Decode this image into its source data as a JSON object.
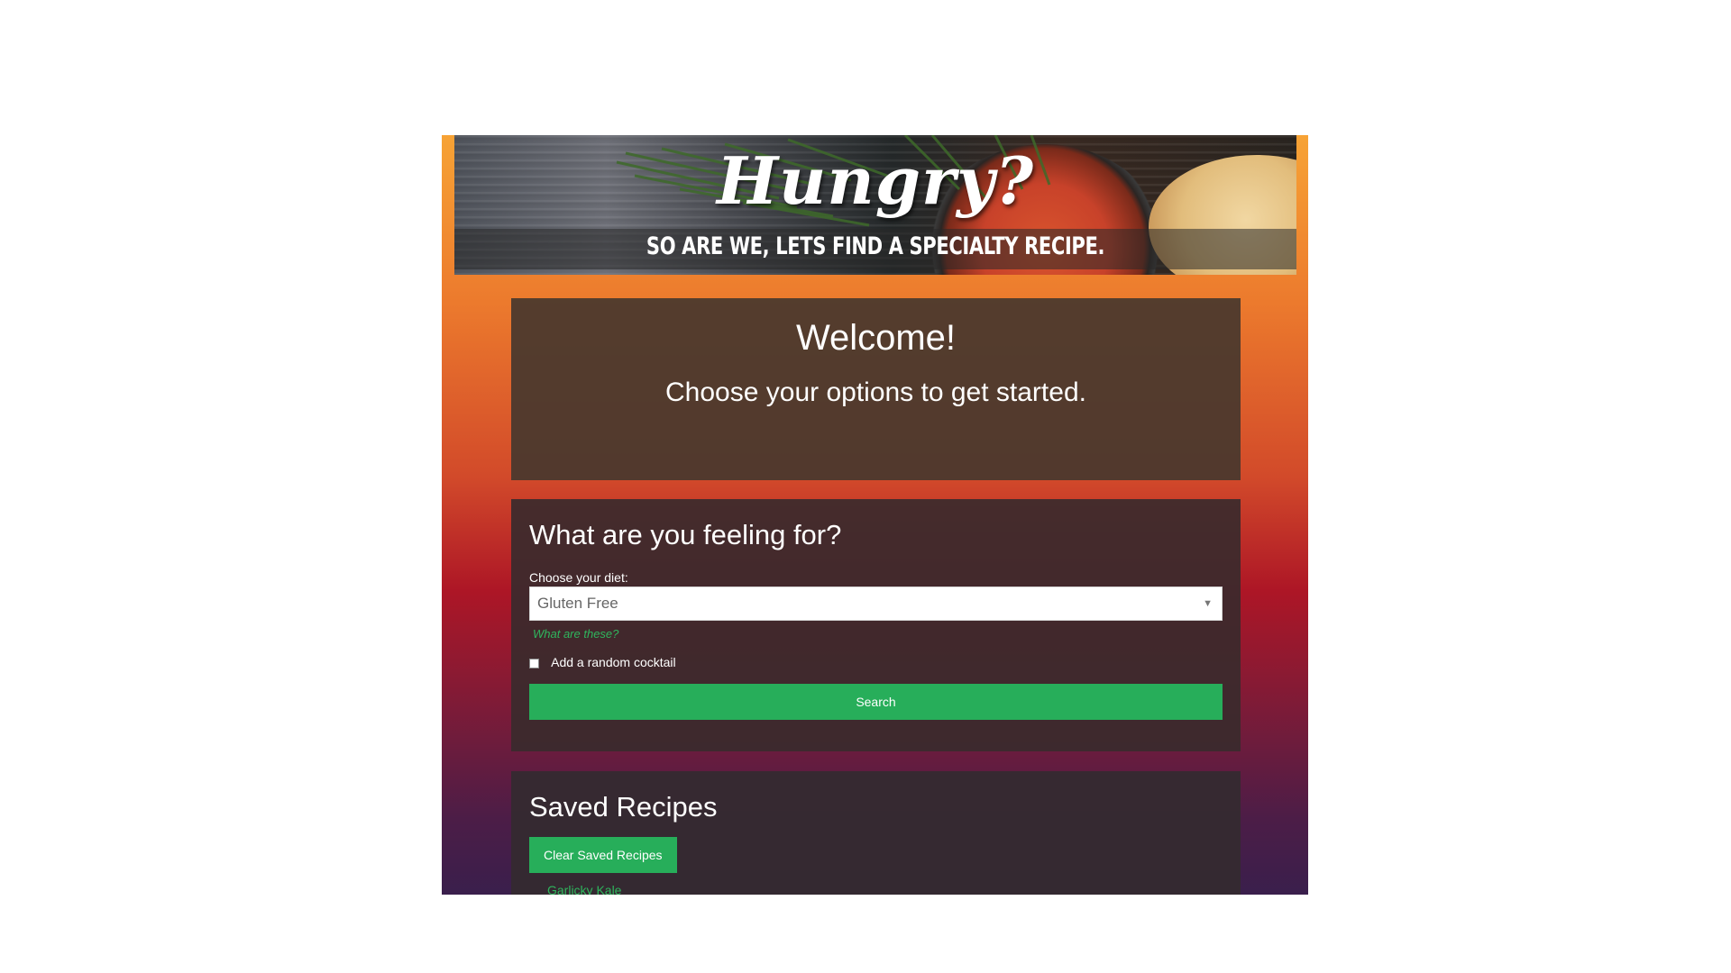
{
  "banner": {
    "title": "Hungry?",
    "subtitle": "SO ARE WE, LETS FIND A SPECIALTY RECIPE."
  },
  "welcome": {
    "heading": "Welcome!",
    "text": "Choose your options to get started."
  },
  "search_form": {
    "heading": "What are you feeling for?",
    "diet_label": "Choose your diet:",
    "diet_selected": "Gluten Free",
    "help_link": "What are these?",
    "cocktail_label": "Add a random cocktail",
    "cocktail_checked": false,
    "search_button": "Search"
  },
  "saved_recipes": {
    "heading": "Saved Recipes",
    "clear_button": "Clear Saved Recipes",
    "items": [
      "Garlicky Kale"
    ]
  },
  "colors": {
    "accent_green": "#27ae5a",
    "card_bg": "#392a2d",
    "gradient_top": "#f7a335",
    "gradient_bottom": "#3a1f4c"
  }
}
